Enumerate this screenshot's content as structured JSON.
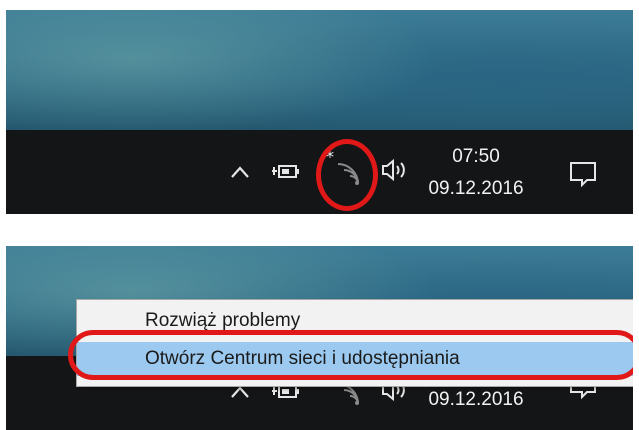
{
  "top_panel": {
    "taskbar": {
      "clock": {
        "time": "07:50",
        "date": "09.12.2016"
      },
      "tray_icons": [
        "chevron-up-icon",
        "battery-icon",
        "wifi-icon",
        "volume-icon",
        "notification-icon"
      ]
    },
    "highlight_color": "#e01818"
  },
  "bottom_panel": {
    "context_menu": {
      "items": [
        {
          "label": "Rozwiąż problemy"
        },
        {
          "label": "Otwórz Centrum sieci i udostępniania",
          "highlighted": true
        }
      ]
    },
    "taskbar": {
      "clock": {
        "date": "09.12.2016"
      }
    },
    "highlight_color": "#e01818",
    "hover_color": "#9cc9ef"
  }
}
